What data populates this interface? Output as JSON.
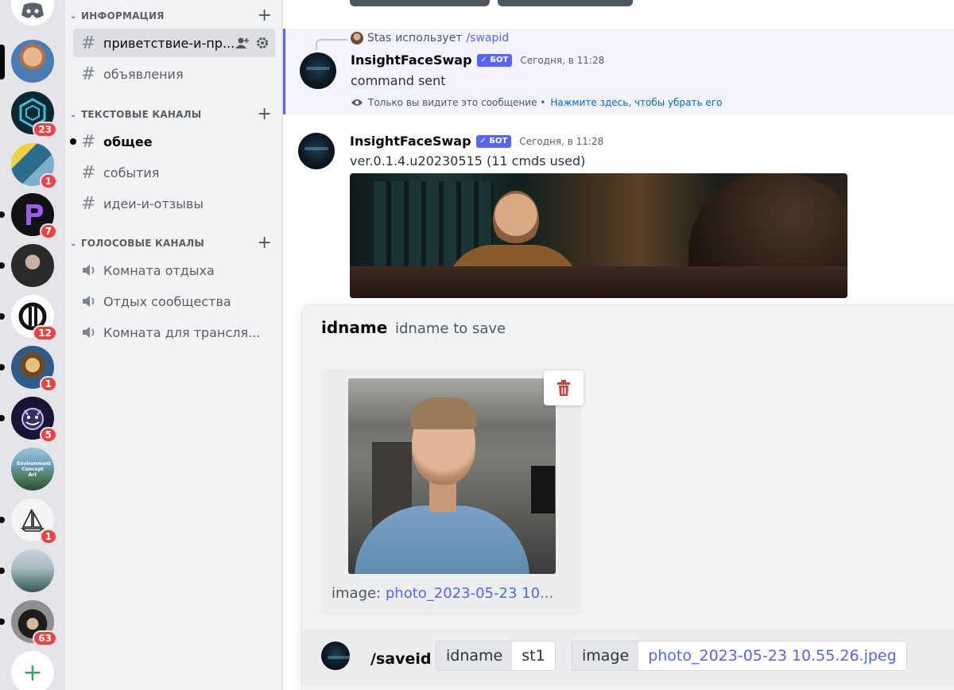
{
  "servers": [
    {
      "name": "discord-home",
      "badge": ""
    },
    {
      "name": "server-portrait-man",
      "badge": ""
    },
    {
      "name": "server-hex",
      "badge": "23"
    },
    {
      "name": "server-arcade",
      "badge": "1"
    },
    {
      "name": "server-purple-p",
      "badge": "7"
    },
    {
      "name": "server-dark-portrait",
      "badge": ""
    },
    {
      "name": "server-m-logo",
      "badge": "12"
    },
    {
      "name": "server-mona-lisa",
      "badge": "1"
    },
    {
      "name": "server-devil-face",
      "badge": "5"
    },
    {
      "name": "server-environment-concept-art",
      "badge": "",
      "caption": "Environment Concept Art"
    },
    {
      "name": "server-sailboat",
      "badge": "1"
    },
    {
      "name": "server-landscape",
      "badge": ""
    },
    {
      "name": "server-hooded",
      "badge": "63"
    },
    {
      "name": "add-server",
      "badge": ""
    }
  ],
  "sidebar": {
    "categories": [
      {
        "label": "ИНФОРМАЦИЯ"
      },
      {
        "label": "ТЕКСТОВЫЕ КАНАЛЫ"
      },
      {
        "label": "ГОЛОСОВЫЕ КАНАЛЫ"
      }
    ],
    "channels": [
      {
        "label": "приветствие-и-пр..."
      },
      {
        "label": "объявления"
      },
      {
        "label": "общее"
      },
      {
        "label": "события"
      },
      {
        "label": "идеи-и-отзывы"
      },
      {
        "label": "Комната отдыха"
      },
      {
        "label": "Отдых сообщества"
      },
      {
        "label": "Комната для трансля..."
      }
    ]
  },
  "messages": [
    {
      "reply_user": "Stas",
      "reply_text": "использует",
      "reply_command": "/swapid",
      "author": "InsightFaceSwap",
      "bot_badge": "✓ БОТ",
      "timestamp": "Сегодня, в 11:28",
      "text": "command sent",
      "ephemeral_note": "Только вы видите это сообщение •",
      "ephemeral_link": "Нажмите здесь, чтобы убрать его"
    },
    {
      "author": "InsightFaceSwap",
      "bot_badge": "✓ БОТ",
      "timestamp": "Сегодня, в 11:28",
      "text": "ver.0.1.4.u20230515 (11 cmds used)"
    }
  ],
  "modal": {
    "option_name": "idname",
    "option_desc": "idname to save",
    "image_label": "image:",
    "image_file": "photo_2023-05-23 10..."
  },
  "command_bar": {
    "command": "/saveid",
    "params": [
      {
        "key": "idname",
        "value": "st1"
      },
      {
        "key": "image",
        "value": "photo_2023-05-23 10.55.26.jpeg"
      }
    ]
  }
}
